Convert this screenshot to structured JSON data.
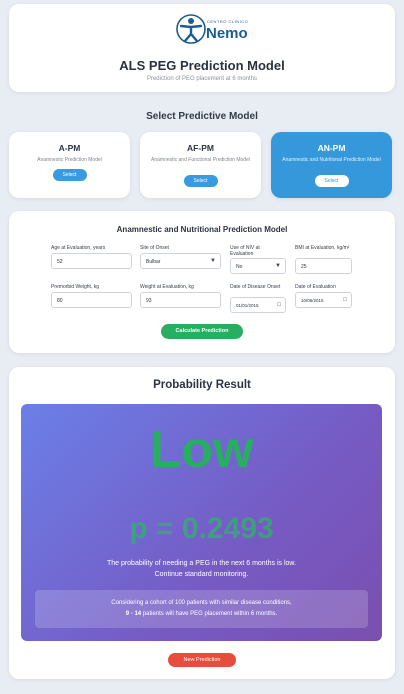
{
  "header": {
    "logo_small": "CENTRO CLINICO",
    "logo_name": "Nemo",
    "title": "ALS PEG Prediction Model",
    "subtitle": "Prediction of PEG placement at 6 months"
  },
  "models_section": {
    "title": "Select Predictive Model",
    "select_label": "Select",
    "models": [
      {
        "code": "A-PM",
        "name": "Anamnestic Prediction Model"
      },
      {
        "code": "AF-PM",
        "name": "Anamnestic and Functional Prediction Model"
      },
      {
        "code": "AN-PM",
        "name": "Anamnestic and Nutritional Prediction Model"
      }
    ],
    "selected_index": 2
  },
  "form": {
    "title": "Anamnestic and Nutritional Prediction Model",
    "age_label": "Age at Evaluation, years",
    "age_value": "52",
    "onset_label": "Site of Onset",
    "onset_value": "Bulbar",
    "niv_label": "Use of NIV at Evaluation",
    "niv_value": "No",
    "bmi_label": "BMI at Evaluation, kg/m²",
    "bmi_value": "25",
    "premorbid_label": "Premorbid Weight, kg",
    "premorbid_value": "80",
    "weight_label": "Weight at Evaluation, kg",
    "weight_value": "93",
    "onset_date_label": "Date of Disease Onset",
    "onset_date_value": "01/01/2015",
    "eval_date_label": "Date of Evaluation",
    "eval_date_value": "10/06/2015",
    "calc_label": "Calculate Prediction"
  },
  "result": {
    "title": "Probability Result",
    "risk": "Low",
    "p_value": "p = 0.2493",
    "message_1": "The probability of needing a PEG in the next 6 months is low.",
    "message_2": "Continue standard monitoring.",
    "cohort_1": "Considering a cohort of 100 patients with similar disease conditions,",
    "cohort_range": "9 - 14",
    "cohort_2": "patients will have PEG placement within 6 months.",
    "new_label": "New Prediction"
  },
  "colors": {
    "accent": "#3498db",
    "success": "#27ae60",
    "danger": "#e74c3c",
    "result_gradient_start": "#6b7fe8",
    "result_gradient_end": "#7a4fb0"
  }
}
